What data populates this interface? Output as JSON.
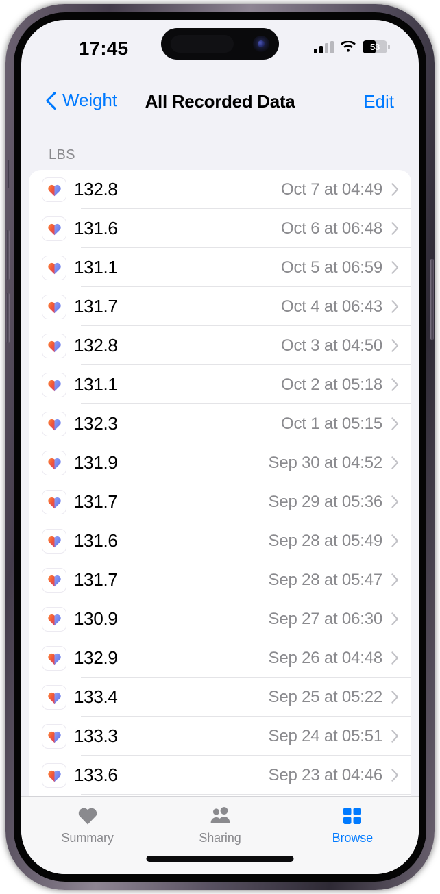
{
  "status_bar": {
    "time": "17:45",
    "signal_icon": "cellular-signal-icon",
    "wifi_icon": "wifi-icon",
    "battery_icon": "battery-icon",
    "battery_level": "53",
    "battery_percent": 53
  },
  "nav_bar": {
    "back_label": "Weight",
    "back_icon": "chevron-left-icon",
    "title": "All Recorded Data",
    "edit_label": "Edit"
  },
  "content": {
    "section_header": "LBS",
    "row_icon": "health-heart-icon",
    "row_chevron_icon": "chevron-right-icon",
    "rows": [
      {
        "value": "132.8",
        "date": "Oct 7 at 04:49"
      },
      {
        "value": "131.6",
        "date": "Oct 6 at 06:48"
      },
      {
        "value": "131.1",
        "date": "Oct 5 at 06:59"
      },
      {
        "value": "131.7",
        "date": "Oct 4 at 06:43"
      },
      {
        "value": "132.8",
        "date": "Oct 3 at 04:50"
      },
      {
        "value": "131.1",
        "date": "Oct 2 at 05:18"
      },
      {
        "value": "132.3",
        "date": "Oct 1 at 05:15"
      },
      {
        "value": "131.9",
        "date": "Sep 30 at 04:52"
      },
      {
        "value": "131.7",
        "date": "Sep 29 at 05:36"
      },
      {
        "value": "131.6",
        "date": "Sep 28 at 05:49"
      },
      {
        "value": "131.7",
        "date": "Sep 28 at 05:47"
      },
      {
        "value": "130.9",
        "date": "Sep 27 at 06:30"
      },
      {
        "value": "132.9",
        "date": "Sep 26 at 04:48"
      },
      {
        "value": "133.4",
        "date": "Sep 25 at 05:22"
      },
      {
        "value": "133.3",
        "date": "Sep 24 at 05:51"
      },
      {
        "value": "133.6",
        "date": "Sep 23 at 04:46"
      },
      {
        "value": "",
        "date": ""
      }
    ]
  },
  "tab_bar": {
    "items": [
      {
        "label": "Summary",
        "icon": "heart-icon",
        "active": false
      },
      {
        "label": "Sharing",
        "icon": "people-icon",
        "active": false
      },
      {
        "label": "Browse",
        "icon": "grid-squares-icon",
        "active": true
      }
    ]
  },
  "colors": {
    "accent_blue": "#007aff",
    "background": "#f2f2f7",
    "card": "#ffffff",
    "secondary_text": "#8a8a8e",
    "heart_left": "#f0553a",
    "heart_right": "#7a8ef0"
  }
}
